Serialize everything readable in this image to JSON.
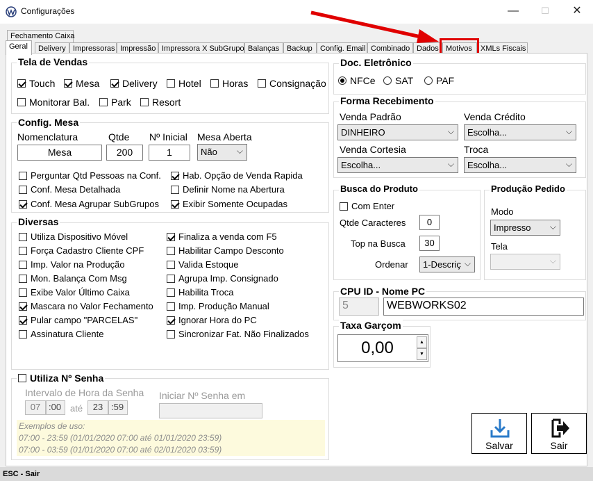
{
  "window": {
    "title": "Configurações",
    "min_glyph": "—",
    "max_glyph": "☐",
    "close_glyph": "✕"
  },
  "tabs_top": [
    "Fechamento Caixa"
  ],
  "tabs": [
    "Geral",
    "Delivery",
    "Impressoras",
    "Impressão",
    "Impressora X SubGrupo",
    "Balanças",
    "Backup",
    "Config. Email",
    "Combinado",
    "Dados",
    "Motivos",
    "XMLs Fiscais"
  ],
  "tela_vendas": {
    "title": "Tela de Vendas",
    "items": [
      {
        "label": "Touch",
        "checked": true
      },
      {
        "label": "Mesa",
        "checked": true
      },
      {
        "label": "Delivery",
        "checked": true
      },
      {
        "label": "Hotel",
        "checked": false
      },
      {
        "label": "Horas",
        "checked": false
      },
      {
        "label": "Consignação",
        "checked": false
      },
      {
        "label": "Monitorar Bal.",
        "checked": false
      },
      {
        "label": "Park",
        "checked": false
      },
      {
        "label": "Resort",
        "checked": false
      }
    ]
  },
  "config_mesa": {
    "title": "Config. Mesa",
    "nomenclatura_label": "Nomenclatura",
    "nomenclatura_value": "Mesa",
    "qtde_label": "Qtde",
    "qtde_value": "200",
    "inicial_label": "Nº Inicial",
    "inicial_value": "1",
    "aberta_label": "Mesa Aberta",
    "aberta_value": "Não",
    "options": [
      {
        "label": "Perguntar Qtd Pessoas na Conf.",
        "checked": false
      },
      {
        "label": "Hab. Opção de Venda Rapida",
        "checked": true
      },
      {
        "label": "Conf. Mesa Detalhada",
        "checked": false
      },
      {
        "label": "Definir Nome na Abertura",
        "checked": false
      },
      {
        "label": "Conf. Mesa Agrupar SubGrupos",
        "checked": true
      },
      {
        "label": "Exibir Somente Ocupadas",
        "checked": true
      }
    ]
  },
  "diversas": {
    "title": "Diversas",
    "left": [
      {
        "label": "Utiliza Dispositivo Móvel",
        "checked": false
      },
      {
        "label": "Força Cadastro Cliente CPF",
        "checked": false
      },
      {
        "label": "Imp. Valor na Produção",
        "checked": false
      },
      {
        "label": "Mon. Balança Com Msg",
        "checked": false
      },
      {
        "label": "Exibe Valor Último Caixa",
        "checked": false
      },
      {
        "label": "Mascara no Valor Fechamento",
        "checked": true
      },
      {
        "label": "Pular campo \"PARCELAS\"",
        "checked": true
      },
      {
        "label": "Assinatura Cliente",
        "checked": false
      }
    ],
    "right": [
      {
        "label": "Finaliza a venda com F5",
        "checked": true
      },
      {
        "label": "Habilitar Campo Desconto",
        "checked": false
      },
      {
        "label": "Valida Estoque",
        "checked": false
      },
      {
        "label": "Agrupa Imp. Consignado",
        "checked": false
      },
      {
        "label": "Habilita Troca",
        "checked": false
      },
      {
        "label": "Imp. Produção Manual",
        "checked": false
      },
      {
        "label": "Ignorar Hora do PC",
        "checked": true
      },
      {
        "label": "Sincronizar Fat. Não Finalizados",
        "checked": false
      }
    ]
  },
  "senha": {
    "title": "Utiliza Nº Senha",
    "checked": false,
    "intervalo_label": "Intervalo de Hora da Senha",
    "start_h": "07",
    "start_m": ":00",
    "ate": "até",
    "end_h": "23",
    "end_m": ":59",
    "iniciar_label": "Iniciar Nº Senha em",
    "iniciar_value": "",
    "examples": [
      "Exemplos de uso:",
      "07:00 - 23:59 (01/01/2020 07:00 até 01/01/2020 23:59)",
      "07:00 - 03:59 (01/01/2020 07:00 até 02/01/2020 03:59)"
    ]
  },
  "doc_eletronico": {
    "title": "Doc. Eletrônico",
    "options": [
      {
        "label": "NFCe",
        "selected": true
      },
      {
        "label": "SAT",
        "selected": false
      },
      {
        "label": "PAF",
        "selected": false
      }
    ]
  },
  "forma_recebimento": {
    "title": "Forma Recebimento",
    "venda_padrao_label": "Venda Padrão",
    "venda_padrao_value": "DINHEIRO",
    "venda_credito_label": "Venda Crédito",
    "venda_credito_value": "Escolha...",
    "venda_cortesia_label": "Venda Cortesia",
    "venda_cortesia_value": "Escolha...",
    "troca_label": "Troca",
    "troca_value": "Escolha..."
  },
  "busca_produto": {
    "title": "Busca do Produto",
    "com_enter_label": "Com Enter",
    "com_enter_checked": false,
    "qtde_label": "Qtde Caracteres",
    "qtde_value": "0",
    "top_label": "Top na Busca",
    "top_value": "30",
    "ordenar_label": "Ordenar",
    "ordenar_value": "1-Descriç"
  },
  "producao_pedido": {
    "title": "Produção Pedido",
    "modo_label": "Modo",
    "modo_value": "Impresso",
    "tela_label": "Tela",
    "tela_value": ""
  },
  "cpu": {
    "title": "CPU ID - Nome PC",
    "id_value": "5",
    "name_value": "WEBWORKS02"
  },
  "taxa": {
    "title": "Taxa Garçom",
    "value": "0,00"
  },
  "actions": {
    "save_label": "Salvar",
    "exit_label": "Sair"
  },
  "status_bar": "ESC - Sair",
  "colors": {
    "highlight": "#e00000",
    "save_icon": "#2b7bc9",
    "example_bg": "#fdfadd"
  }
}
